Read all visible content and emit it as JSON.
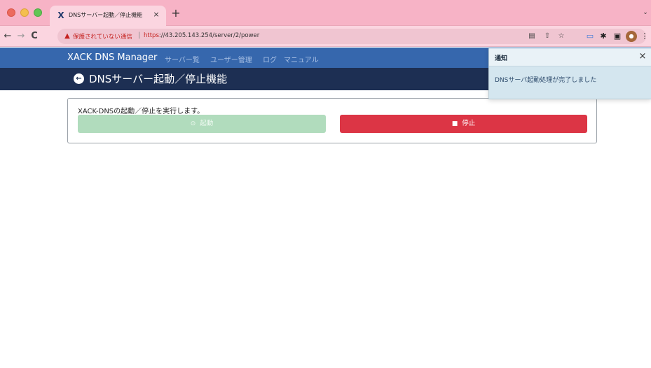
{
  "browser": {
    "tab_title": "DNSサーバー起動／停止機能",
    "tab_close": "×",
    "new_tab": "+",
    "insecure_label": "保護されていない通信",
    "url_scheme": "https",
    "url_rest": "://43.205.143.254/server/2/power"
  },
  "nav": {
    "brand": "XACK DNS Manager",
    "links": [
      "サーバー覧",
      "ユーザー管理",
      "ログ",
      "マニュアル"
    ]
  },
  "page": {
    "title": "DNSサーバー起動／停止機能"
  },
  "card": {
    "description": "XACK-DNSの起動／停止を実行します。",
    "start_label": "起動",
    "stop_label": "停止"
  },
  "toast": {
    "title": "通知",
    "close": "×",
    "message": "DNSサーバ起動処理が完了しました"
  },
  "colors": {
    "nav_bg": "#3667ad",
    "title_bg": "#1d2f53",
    "start_disabled": "#b1dcbd",
    "stop": "#dc3545",
    "toast_bg": "#d4e6ef"
  }
}
